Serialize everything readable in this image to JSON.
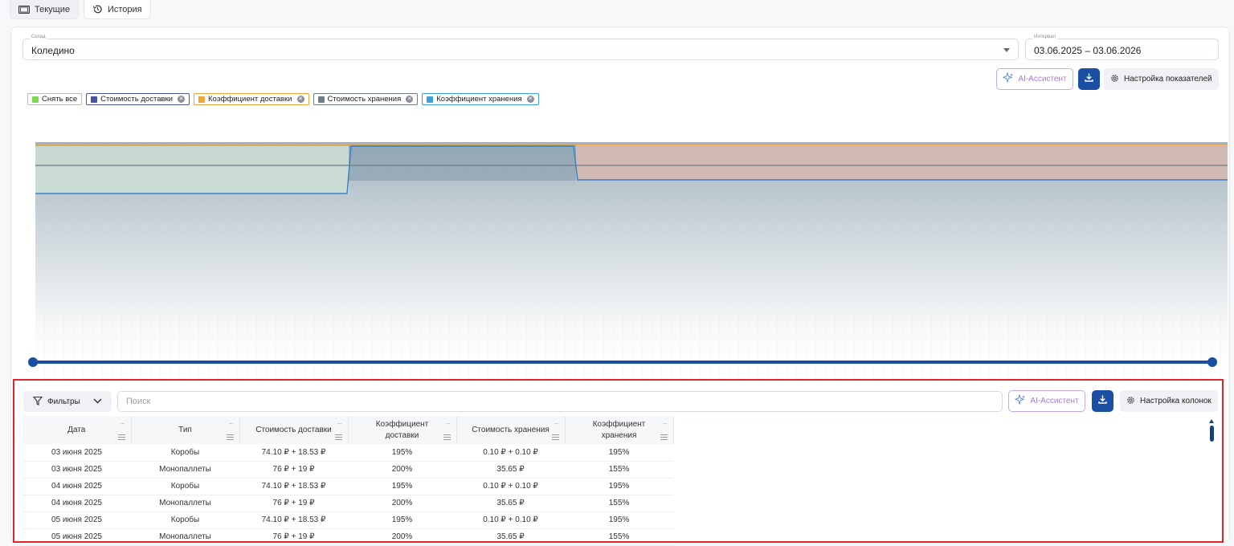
{
  "tabs": [
    {
      "label": "Текущие",
      "icon": "tablet-icon"
    },
    {
      "label": "История",
      "icon": "history-icon"
    }
  ],
  "filters": {
    "warehouse": {
      "label": "Склад",
      "value": "Коледино"
    },
    "interval": {
      "label": "Интервал",
      "value": "03.06.2025 – 03.06.2026"
    }
  },
  "chart_toolbar": {
    "ai_label": "AI-Ассистент",
    "settings_label": "Настройка показателей"
  },
  "legend": {
    "clear_all": "Снять все",
    "clear_color": "#7ed957",
    "items": [
      {
        "label": "Стоимость доставки",
        "color": "#4a55a2"
      },
      {
        "label": "Коэффициент доставки",
        "color": "#f2a33a"
      },
      {
        "label": "Стоимость хранения",
        "color": "#6f7c85"
      },
      {
        "label": "Коэффициент хранения",
        "color": "#3aa3d9"
      }
    ]
  },
  "table_toolbar": {
    "filters_label": "Фильтры",
    "search_placeholder": "Поиск",
    "ai_label": "AI-Ассистент",
    "settings_label": "Настройка колонок"
  },
  "table": {
    "columns": [
      {
        "l1": "Дата",
        "l2": ""
      },
      {
        "l1": "Тип",
        "l2": ""
      },
      {
        "l1": "Стоимость доставки",
        "l2": ""
      },
      {
        "l1": "Коэффициент",
        "l2": "доставки"
      },
      {
        "l1": "Стоимость хранения",
        "l2": ""
      },
      {
        "l1": "Коэффициент",
        "l2": "хранения"
      }
    ],
    "rows": [
      [
        "03 июня 2025",
        "Коробы",
        "74.10 ₽ + 18.53 ₽",
        "195%",
        "0.10 ₽ + 0.10 ₽",
        "195%"
      ],
      [
        "03 июня 2025",
        "Монопаллеты",
        "76 ₽ + 19 ₽",
        "200%",
        "35.65 ₽",
        "155%"
      ],
      [
        "04 июня 2025",
        "Коробы",
        "74.10 ₽ + 18.53 ₽",
        "195%",
        "0.10 ₽ + 0.10 ₽",
        "195%"
      ],
      [
        "04 июня 2025",
        "Монопаллеты",
        "76 ₽ + 19 ₽",
        "200%",
        "35.65 ₽",
        "155%"
      ],
      [
        "05 июня 2025",
        "Коробы",
        "74.10 ₽ + 18.53 ₽",
        "195%",
        "0.10 ₽ + 0.10 ₽",
        "195%"
      ],
      [
        "05 июня 2025",
        "Монопаллеты",
        "76 ₽ + 19 ₽",
        "200%",
        "35.65 ₽",
        "155%"
      ]
    ]
  },
  "colors": {
    "accent": "#1b4fa3",
    "ai": "#a978d6",
    "highlight": "#e0242b"
  }
}
